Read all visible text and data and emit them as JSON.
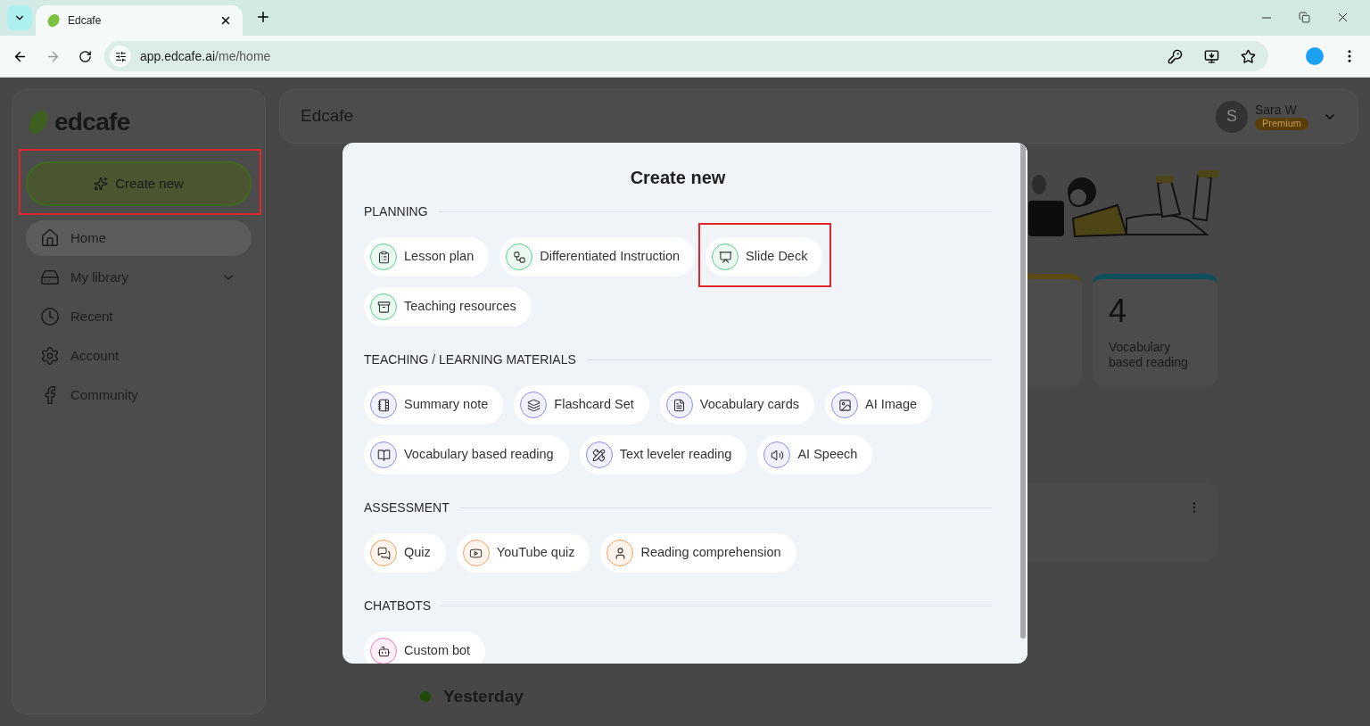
{
  "browser": {
    "tab_title": "Edcafe",
    "url_host": "app.edcafe.ai",
    "url_path": "/me/home"
  },
  "sidebar": {
    "logo": "edcafe",
    "create_button": {
      "label": "Create new",
      "highlighted": true
    },
    "items": [
      {
        "label": "Home",
        "selected": true,
        "expandable": false
      },
      {
        "label": "My library",
        "selected": false,
        "expandable": true
      },
      {
        "label": "Recent",
        "selected": false,
        "expandable": false
      },
      {
        "label": "Account",
        "selected": false,
        "expandable": false
      },
      {
        "label": "Community",
        "selected": false,
        "expandable": false
      }
    ]
  },
  "header": {
    "title": "Edcafe",
    "avatar": "S",
    "user": "Sara W",
    "badge": "Premium"
  },
  "stat_card": {
    "value": "4",
    "label": "Vocabulary based reading"
  },
  "timeline": {
    "heading": "Yesterday"
  },
  "modal": {
    "title": "Create new",
    "sections": [
      {
        "title": "PLANNING",
        "color": "#5ccf8a",
        "items": [
          {
            "label": "Lesson plan",
            "highlighted": false
          },
          {
            "label": "Differentiated Instruction",
            "highlighted": false
          },
          {
            "label": "Slide Deck",
            "highlighted": true
          },
          {
            "label": "Teaching resources",
            "highlighted": false
          }
        ]
      },
      {
        "title": "TEACHING / LEARNING MATERIALS",
        "color": "#8a8cf0",
        "items": [
          {
            "label": "Summary note",
            "highlighted": false
          },
          {
            "label": "Flashcard Set",
            "highlighted": false
          },
          {
            "label": "Vocabulary cards",
            "highlighted": false
          },
          {
            "label": "AI Image",
            "highlighted": false
          },
          {
            "label": "Vocabulary based reading",
            "highlighted": false
          },
          {
            "label": "Text leveler reading",
            "highlighted": false
          },
          {
            "label": "AI Speech",
            "highlighted": false
          }
        ]
      },
      {
        "title": "ASSESSMENT",
        "color": "#f3a162",
        "items": [
          {
            "label": "Quiz",
            "highlighted": false
          },
          {
            "label": "YouTube quiz",
            "highlighted": false
          },
          {
            "label": "Reading comprehension",
            "highlighted": false
          }
        ]
      },
      {
        "title": "CHATBOTS",
        "color": "#ee7ab8",
        "items": [
          {
            "label": "Custom bot",
            "highlighted": false
          }
        ]
      }
    ]
  }
}
